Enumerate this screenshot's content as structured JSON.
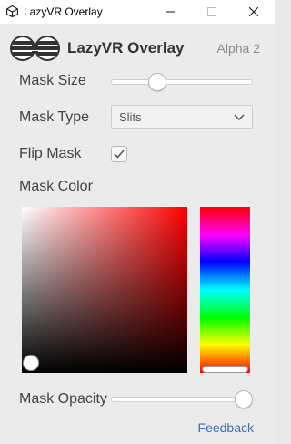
{
  "window": {
    "title": "LazyVR Overlay",
    "controls": {
      "minimize_icon": "minimize-icon",
      "maximize_icon": "maximize-icon",
      "close_icon": "close-icon"
    }
  },
  "header": {
    "app_name": "LazyVR Overlay",
    "version": "Alpha 2",
    "logo_icon": "vr-goggles-logo"
  },
  "mask_size": {
    "label": "Mask Size",
    "value_fraction": 0.3
  },
  "mask_type": {
    "label": "Mask Type",
    "selected": "Slits",
    "chevron_icon": "chevron-down-icon"
  },
  "flip_mask": {
    "label": "Flip Mask",
    "checked": true,
    "check_icon": "checkmark-icon"
  },
  "mask_color": {
    "label": "Mask Color",
    "hue_color": "#ff0000",
    "saturation": 0.0,
    "value": 0.0,
    "hue_position": 1.0
  },
  "mask_opacity": {
    "label": "Mask Opacity",
    "value_fraction": 1.0
  },
  "footer": {
    "feedback_link": "Feedback"
  },
  "colors": {
    "accent_link": "#3d6fb6",
    "background": "#ebebeb",
    "titlebar": "#ffffff"
  }
}
